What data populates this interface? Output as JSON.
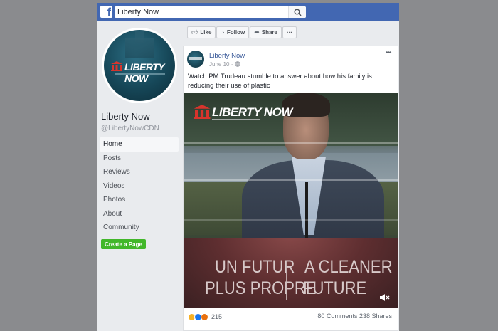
{
  "topbar": {
    "logo": "f",
    "search_value": "Liberty Now",
    "search_icon": "search-icon"
  },
  "profile": {
    "avatar_brand": "LIBERTY NOW",
    "name": "Liberty Now",
    "handle": "@LibertyNowCDN"
  },
  "nav": {
    "items": [
      {
        "label": "Home",
        "active": true
      },
      {
        "label": "Posts"
      },
      {
        "label": "Reviews"
      },
      {
        "label": "Videos"
      },
      {
        "label": "Photos"
      },
      {
        "label": "About"
      },
      {
        "label": "Community"
      }
    ],
    "create_page": "Create a Page"
  },
  "actions": {
    "like": "Like",
    "follow": "Follow",
    "share": "Share",
    "more": "···"
  },
  "post": {
    "author": "Liberty Now",
    "date": "June 10 · ",
    "more": "•••",
    "text": "Watch PM Trudeau stumble to answer about how his family is reducing their use of plastic",
    "video": {
      "logo_text": "LIBERTY NOW",
      "podium_line1_left": "UN FUTUR",
      "podium_line1_right": "A CLEANER",
      "podium_line2_left": "PLUS PROPRE",
      "podium_line2_right": "FUTURE",
      "mute_icon": "speaker-muted-icon"
    },
    "reaction_count": "215",
    "comments": "80 Comments",
    "shares": "238 Shares"
  },
  "colors": {
    "brand_blue": "#4267b2",
    "link_blue": "#385898",
    "create_green": "#42b72a"
  }
}
